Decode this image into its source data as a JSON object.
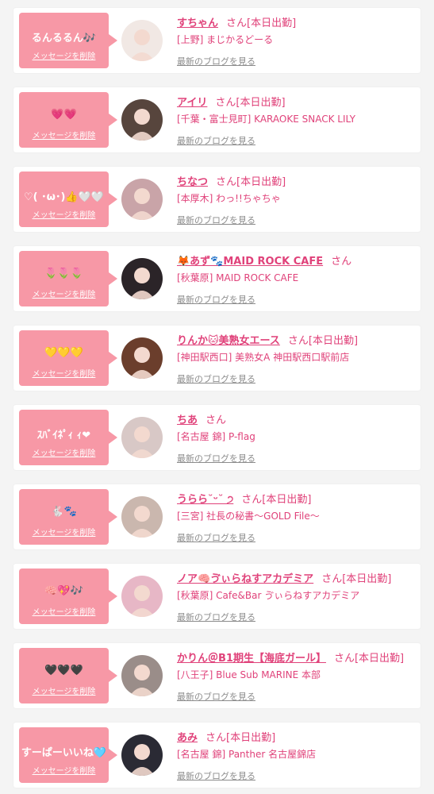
{
  "theme": {
    "accent": "#f798a6",
    "name_color": "#e0427a",
    "muted": "#8c8c8c"
  },
  "labels": {
    "delete": "メッセージを削除",
    "blog": "最新のブログを見る",
    "san": "さん"
  },
  "entries": [
    {
      "message": "るんるるん🎶",
      "name": "すちゃん",
      "status": "[本日出勤]",
      "shop": "[上野] まじかるどーる",
      "avatar_color": "#f1e8e4"
    },
    {
      "message": "💗💗",
      "name": "アイリ",
      "status": "[本日出勤]",
      "shop": "[千葉・富士見町] KARAOKE SNACK LILY",
      "avatar_color": "#57453d"
    },
    {
      "message": "♡( ･ω･)👍🤍🤍",
      "name": "ちなつ",
      "status": "[本日出勤]",
      "shop": "[本厚木] わっ!!ちゃちゃ",
      "avatar_color": "#c9a4a8"
    },
    {
      "message": "🌷🌷🌷",
      "name": "🦊あず🐾MAID ROCK CAFE",
      "status": "",
      "shop": "[秋葉原] MAID ROCK CAFE",
      "avatar_color": "#2b2428"
    },
    {
      "message": "💛💛💛",
      "name": "りんか🐱美熟女エース",
      "status": "[本日出勤]",
      "shop": "[神田駅西口] 美熟女A 神田駅西口駅前店",
      "avatar_color": "#6b3e2c"
    },
    {
      "message": "ｽﾊﾞｲﾈﾟｨ ｨ❤",
      "name": "ちあ",
      "status": "",
      "shop": "[名古屋 錦] P-flag",
      "avatar_color": "#d8c8c6"
    },
    {
      "message": "🐇🐾",
      "name": "うらら˘ᵕ˘ ੭",
      "status": "[本日出勤]",
      "shop": "[三宮] 社長の秘書〜GOLD File〜",
      "avatar_color": "#cab7ae"
    },
    {
      "message": "🧠💖🎶",
      "name": "ノア🧠ゔぃらねすアカデミア",
      "status": "[本日出勤]",
      "shop": "[秋葉原] Cafe&Bar ゔぃらねすアカデミア",
      "avatar_color": "#e7b7c6"
    },
    {
      "message": "🖤🖤🖤",
      "name": "かりん＠B1期生【海底ガール】",
      "status": "[本日出勤]",
      "shop": "[八王子] Blue Sub MARINE 本部",
      "avatar_color": "#9a8d89"
    },
    {
      "message": "すーぱーいいね🩵",
      "name": "あみ",
      "status": "[本日出勤]",
      "shop": "[名古屋 錦] Panther 名古屋錦店",
      "avatar_color": "#2a2a34"
    }
  ]
}
